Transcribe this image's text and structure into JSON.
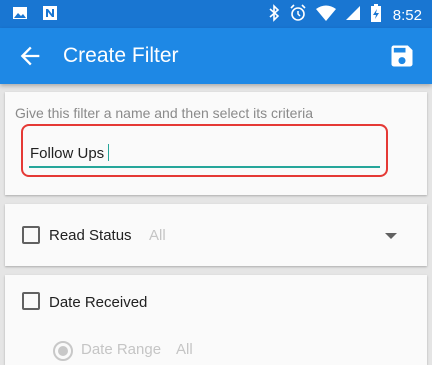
{
  "status_bar": {
    "time": "8:52",
    "left_icons": [
      "image-icon",
      "n-app-icon"
    ],
    "right_icons": [
      "bluetooth-icon",
      "alarm-icon",
      "wifi-icon",
      "signal-icon",
      "battery-icon"
    ]
  },
  "app_bar": {
    "title": "Create Filter",
    "back_icon": "arrow-back-icon",
    "save_icon": "save-icon",
    "colors": {
      "status": "#1976d2",
      "bar": "#1e88e5"
    }
  },
  "name_card": {
    "hint": "Give this filter a name and then select its criteria",
    "value": "Follow Ups",
    "accent_color": "#26a69a",
    "highlight_color": "#e53935"
  },
  "criteria": {
    "read_status": {
      "label": "Read Status",
      "value": "All",
      "checked": false
    },
    "date_received": {
      "label": "Date Received",
      "checked": false,
      "option": {
        "label": "Date Range",
        "value": "All"
      }
    }
  }
}
